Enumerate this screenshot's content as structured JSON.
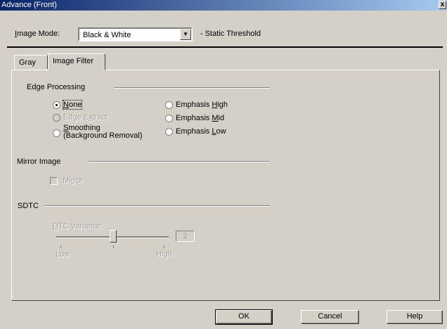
{
  "window": {
    "title": "Advance (Front)",
    "close_glyph": "x"
  },
  "image_mode": {
    "label_prefix": "",
    "label_mnemonic": "I",
    "label_rest": "mage Mode:",
    "value": "Black & White",
    "arrow_glyph": "▼",
    "extra_label": "- Static Threshold"
  },
  "tabs": [
    {
      "label": "Gray",
      "active": false
    },
    {
      "label": "Image Filter",
      "active": true
    }
  ],
  "edge_processing": {
    "title": "Edge Processing",
    "options": {
      "none": {
        "mn": "N",
        "rest": "one",
        "selected": true,
        "enabled": true
      },
      "edge_extract": {
        "pre": "Edge E",
        "mn": "x",
        "rest": "tract",
        "selected": false,
        "enabled": false
      },
      "smoothing": {
        "mn": "S",
        "rest": "moothing",
        "line2": "(Background Removal)",
        "selected": false,
        "enabled": true
      },
      "emphasis_high": {
        "pre": "Emphasis ",
        "mn": "H",
        "rest": "igh",
        "selected": false,
        "enabled": true
      },
      "emphasis_mid": {
        "pre": "Emphasis ",
        "mn": "M",
        "rest": "id",
        "selected": false,
        "enabled": true
      },
      "emphasis_low": {
        "pre": "Emphasis ",
        "mn": "L",
        "rest": "ow",
        "selected": false,
        "enabled": true
      }
    }
  },
  "mirror_image": {
    "title": "Mirror Image",
    "checkbox": {
      "pre": "Mi",
      "mn": "r",
      "rest": "ror",
      "checked": false,
      "enabled": false
    }
  },
  "sdtc": {
    "title": "SDTC",
    "dtc_label_pre": "",
    "dtc_label_mn": "D",
    "dtc_label_rest": "TC Variance:",
    "value": "2",
    "level_fraction": 0.5,
    "low_label": "Low",
    "high_label": "High"
  },
  "buttons": {
    "ok": "OK",
    "cancel": "Cancel",
    "help": "Help"
  }
}
